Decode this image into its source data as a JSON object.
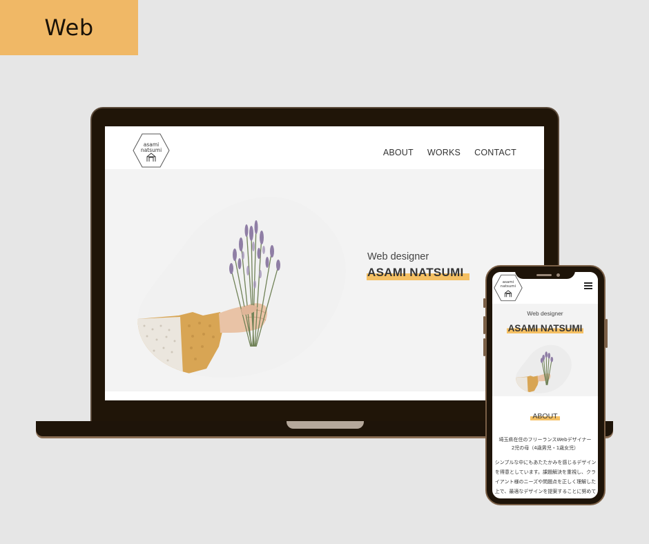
{
  "tag": {
    "label": "Web",
    "color": "#f0b866"
  },
  "site": {
    "logo": {
      "line1": "asami",
      "line2": "natsumi",
      "icon": "house-hexagon-icon"
    },
    "nav": [
      "ABOUT",
      "WORKS",
      "CONTACT"
    ],
    "hero": {
      "subtitle": "Web designer",
      "name": "ASAMI NATSUMI",
      "image": "hand-holding-lavender-bouquet",
      "highlight_color": "#f5c063"
    }
  },
  "mobile": {
    "menu_icon": "hamburger-icon",
    "about_heading": "ABOUT",
    "about_line1": "埼玉県在住のフリーランスWebデザイナー",
    "about_line2": "2児の母（4歳男児・1歳女児）",
    "about_para": "シンプルな中にもあたたかみを感じるデザインを得意としています。課題解決を重視し、クライアント様のニーズや問題点を正しく理解した上で、最適なデザインを提案することに努めています。"
  },
  "colors": {
    "device": "#201508",
    "background": "#e6e6e6",
    "hero_bg": "#f3f3f3"
  }
}
